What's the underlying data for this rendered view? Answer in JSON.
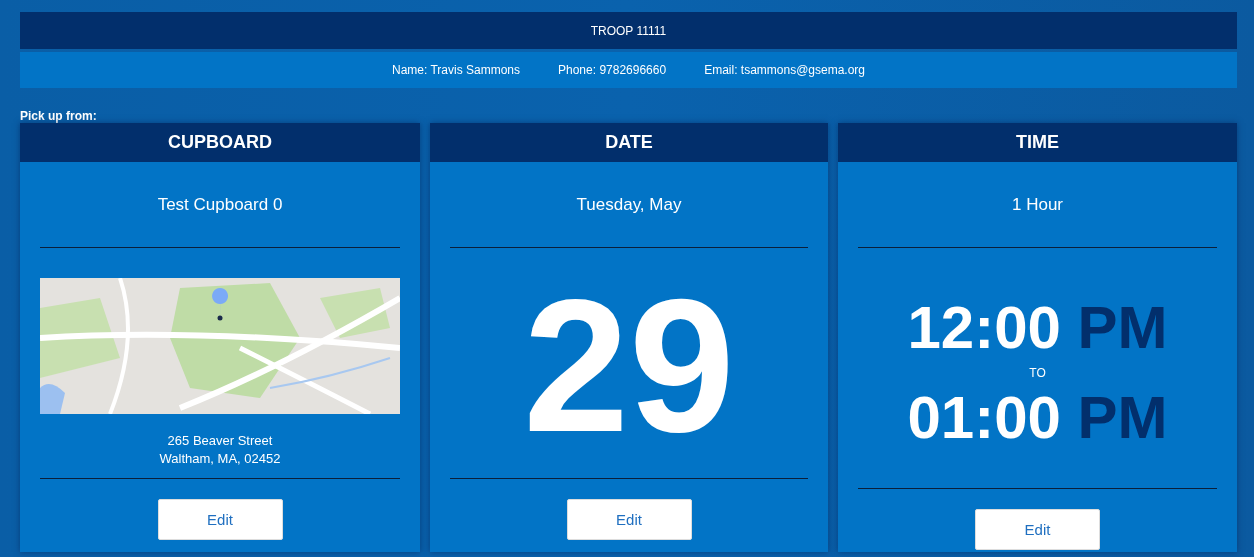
{
  "header": {
    "title": "TROOP 11111"
  },
  "contact": [
    "Name: Travis Sammons",
    "Phone: 9782696660",
    "Email: tsammons@gsema.org"
  ],
  "pickup_label": "Pick up from:",
  "cards": [
    {
      "kind": "cupboard",
      "heading": "CUPBOARD",
      "subtitle": "Test Cupboard 0",
      "map": {
        "kind": "picture"
      },
      "address": [
        "265 Beaver Street",
        "Waltham, MA, 02452"
      ],
      "button": "Edit"
    },
    {
      "kind": "date",
      "heading": "DATE",
      "subtitle": "Tuesday, May",
      "day": "29",
      "button": "Edit"
    },
    {
      "kind": "time",
      "heading": "TIME",
      "subtitle": "1 Hour",
      "start": {
        "time": "12:00",
        "period": "PM"
      },
      "separator": "TO",
      "end": {
        "time": "01:00",
        "period": "PM"
      },
      "button": "Edit"
    }
  ]
}
